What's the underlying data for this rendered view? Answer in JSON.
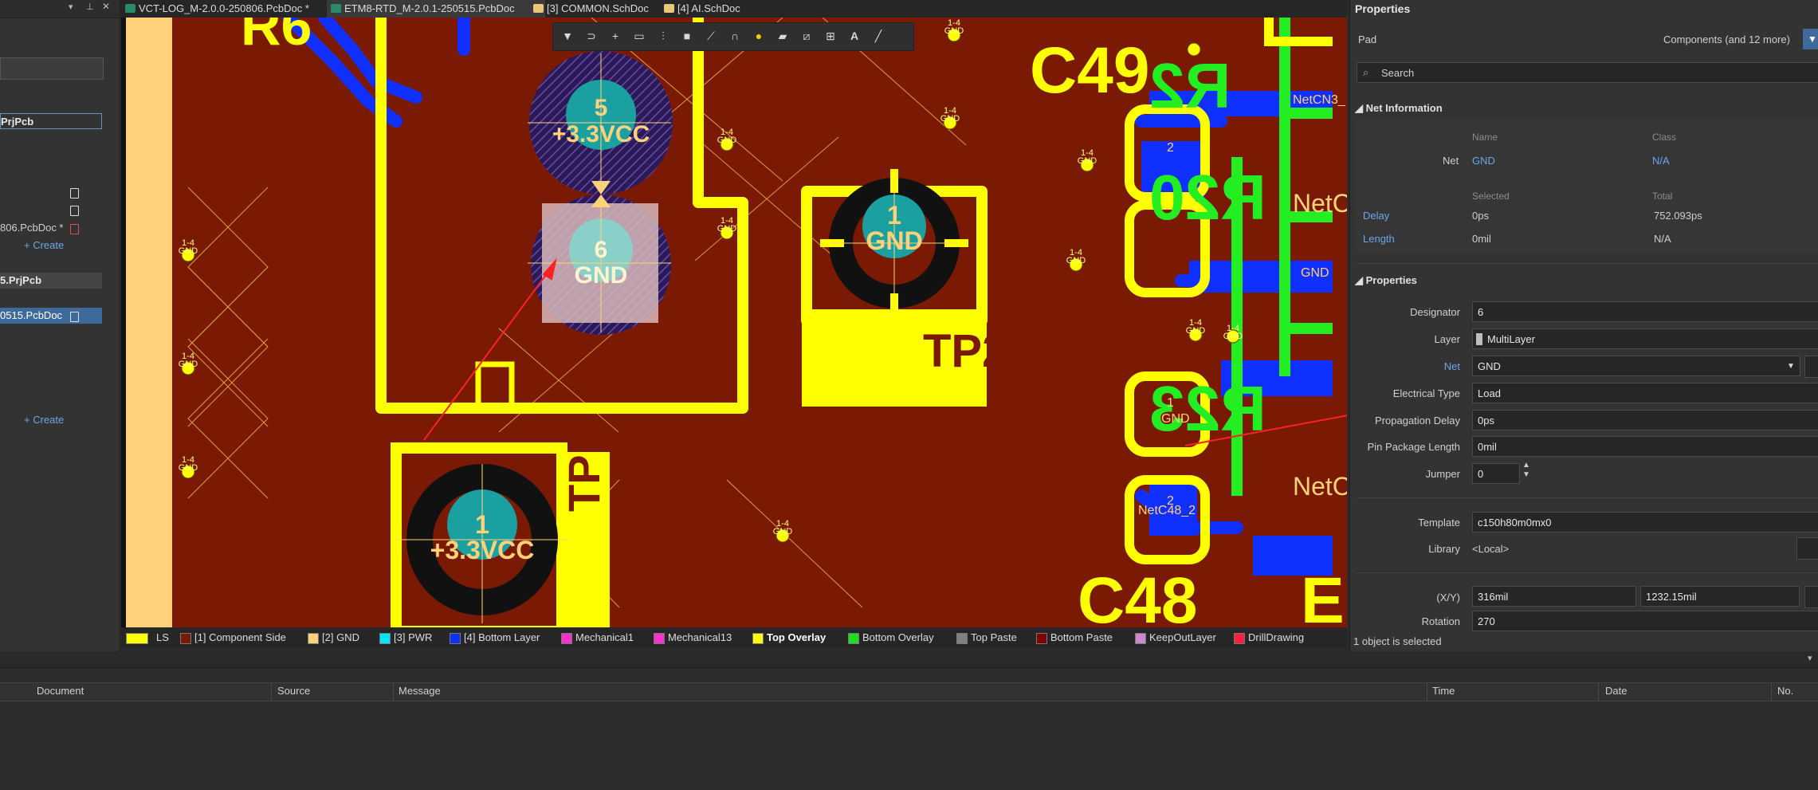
{
  "tabs": [
    {
      "label": "VCT-LOG_M-2.0.0-250806.PcbDoc *",
      "active": false
    },
    {
      "label": "ETM8-RTD_M-2.0.1-250515.PcbDoc",
      "active": true
    },
    {
      "label": "[3] COMMON.SchDoc",
      "active": false
    },
    {
      "label": "[4] AI.SchDoc",
      "active": false
    }
  ],
  "project_panel": {
    "rows": [
      {
        "label": "PrjPcb",
        "bold": true
      },
      {
        "label": "806.PcbDoc *"
      },
      {
        "label": "+ Create"
      },
      {
        "label": "5.PrjPcb",
        "bold": true
      },
      {
        "label": "0515.PcbDoc"
      },
      {
        "label": "+ Create"
      }
    ]
  },
  "pcb": {
    "designators": {
      "c49": "C49",
      "c48": "C48",
      "r2x": "R2",
      "r20": "R20",
      "r21": "R2",
      "r23": "R23",
      "e": "E"
    },
    "tp1": "TP1",
    "tp2": "TP2",
    "pad5": {
      "num": "5",
      "net": "+3.3VCC"
    },
    "pad6": {
      "num": "6",
      "net": "GND"
    },
    "tp2pad": {
      "num": "1",
      "net": "GND"
    },
    "tp1pad": {
      "num": "1",
      "net": "+3.3VCC"
    },
    "via_label": "1-4",
    "via_net": "GND",
    "nets": {
      "netcn3": "NetCN3_",
      "netc1": "NetC",
      "netc2": "NetC",
      "netc48": "NetC48_2",
      "gnd2": "GND",
      "pad2": "2",
      "pad1": "1",
      "c49pad": "C49",
      "gnd": "GND",
      "netco": "NetCo"
    }
  },
  "pcb_toolbar": {
    "icons": [
      "filter-icon",
      "route-icon",
      "cross-icon",
      "select-rect-icon",
      "align-icon",
      "component-icon",
      "interactive-route-icon",
      "diff-pair-icon",
      "place-via-icon",
      "polygon-icon",
      "keepout-icon",
      "dimension-icon",
      "text-icon",
      "line-icon"
    ]
  },
  "layer_bar": [
    {
      "label": "LS",
      "color": "#ffff00"
    },
    {
      "label": "[1] Component Side",
      "color": "#7a1a05"
    },
    {
      "label": "[2] GND",
      "color": "#ffd27a"
    },
    {
      "label": "[3] PWR",
      "color": "#00e5ff"
    },
    {
      "label": "[4] Bottom Layer",
      "color": "#1030ff"
    },
    {
      "label": "Mechanical1",
      "color": "#ff33cc"
    },
    {
      "label": "Mechanical13",
      "color": "#ff33cc"
    },
    {
      "label": "Top Overlay",
      "color": "#ffff00",
      "active": true
    },
    {
      "label": "Bottom Overlay",
      "color": "#22dd22"
    },
    {
      "label": "Top Paste",
      "color": "#808080"
    },
    {
      "label": "Bottom Paste",
      "color": "#800000"
    },
    {
      "label": "KeepOutLayer",
      "color": "#cc88cc"
    },
    {
      "label": "DrillDrawing",
      "color": "#ff2040"
    }
  ],
  "properties": {
    "title": "Properties",
    "object_type": "Pad",
    "filter_label": "Components (and 12 more)",
    "search_placeholder": "Search",
    "net_info": {
      "section": "Net Information",
      "name_header": "Name",
      "class_header": "Class",
      "net_label": "Net",
      "net_name": "GND",
      "net_class": "N/A",
      "selected_header": "Selected",
      "total_header": "Total",
      "delay_label": "Delay",
      "delay_selected": "0ps",
      "delay_total": "752.093ps",
      "length_label": "Length",
      "length_selected": "0mil",
      "length_total": "N/A"
    },
    "props": {
      "section": "Properties",
      "designator_label": "Designator",
      "designator": "6",
      "layer_label": "Layer",
      "layer": "MultiLayer",
      "net_label": "Net",
      "net": "GND",
      "etype_label": "Electrical Type",
      "etype": "Load",
      "pdelay_label": "Propagation Delay",
      "pdelay": "0ps",
      "pinlen_label": "Pin Package Length",
      "pinlen": "0mil",
      "jumper_label": "Jumper",
      "jumper": "0",
      "template_label": "Template",
      "template": "c150h80m0mx0",
      "library_label": "Library",
      "library": "<Local>",
      "xy_label": "(X/Y)",
      "x": "316mil",
      "y": "1232.15mil",
      "rotation_label": "Rotation",
      "rotation": "270"
    },
    "status": "1 object is selected"
  },
  "messages": {
    "columns": [
      "Document",
      "Source",
      "Message",
      "Time",
      "Date",
      "No."
    ]
  }
}
